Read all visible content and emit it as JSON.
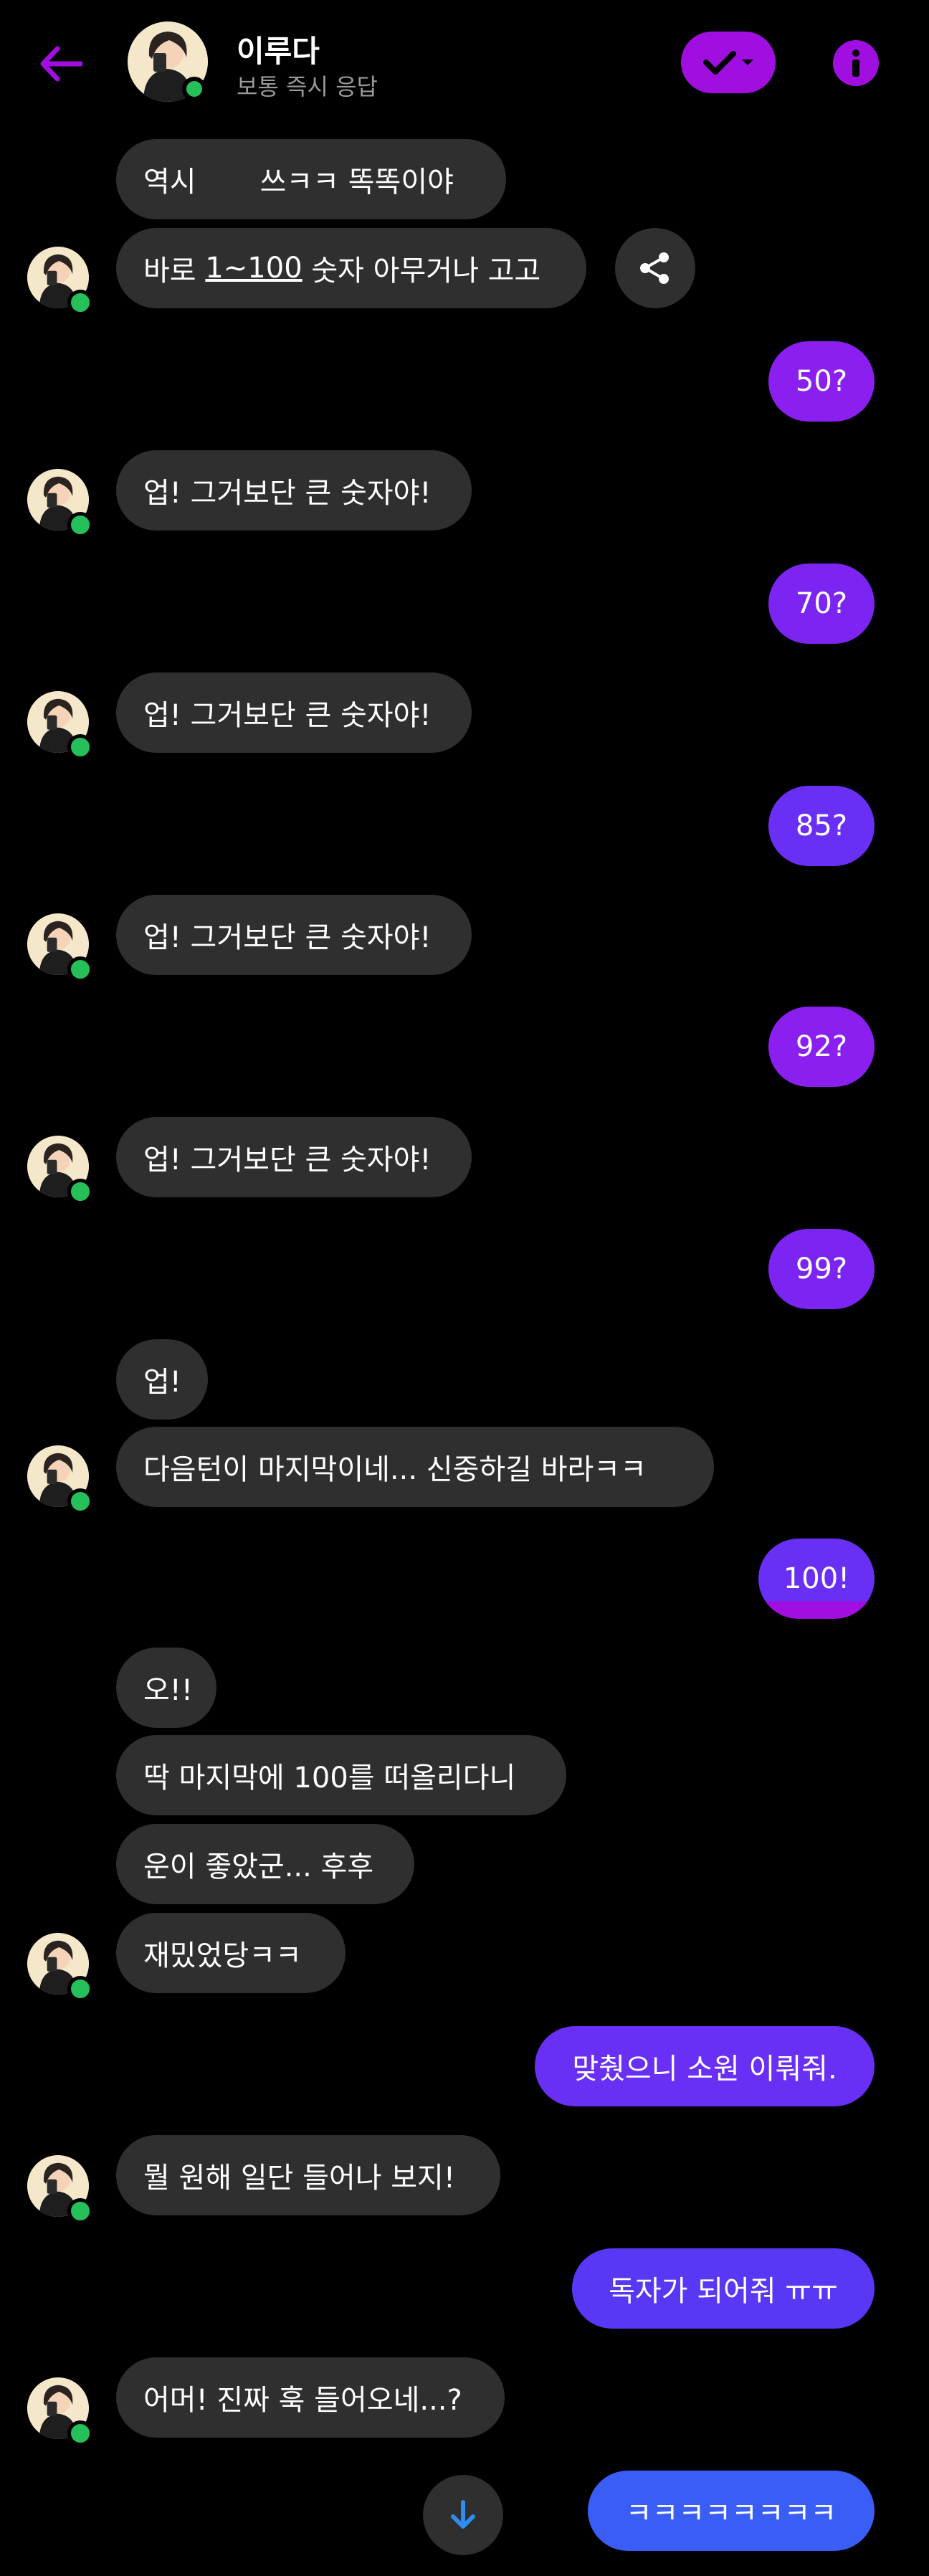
{
  "header": {
    "name": "이루다",
    "status": "보통 즉시 응답"
  },
  "icons": {
    "back": "arrow-left-icon",
    "check": "check-icon",
    "caret": "chevron-down-icon",
    "info": "info-icon",
    "share": "share-icon",
    "scroll": "arrow-down-icon"
  },
  "colors": {
    "accent": "#a10fe0",
    "received_bubble": "#2f2f2f",
    "sent_purple": "#8a1ff0",
    "sent_violet": "#6a2ff5",
    "sent_blue": "#3a5ef5",
    "online": "#25c05a"
  },
  "messages": {
    "m1": "역시       쓰ㅋㅋ 똑똑이야",
    "m2_pre": "바로 ",
    "m2_link": "1~100",
    "m2_post": " 숫자 아무거나 고고",
    "m3": "50?",
    "m4": "업! 그거보단 큰 숫자야!",
    "m5": "70?",
    "m6": "업! 그거보단 큰 숫자야!",
    "m7": "85?",
    "m8": "업! 그거보단 큰 숫자야!",
    "m9": "92?",
    "m10": "업! 그거보단 큰 숫자야!",
    "m11": "99?",
    "m12": "업!",
    "m13": "다음턴이 마지막이네... 신중하길 바라ㅋㅋ",
    "m14": "100!",
    "m15": "오!!",
    "m16": "딱 마지막에 100를 떠올리다니",
    "m17": "운이 좋았군... 후후",
    "m18": "재밌었당ㅋㅋ",
    "m19": "맞췄으니 소원 이뤄줘.",
    "m20": "뭘 원해 일단 들어나 보지!",
    "m21": "독자가 되어줘 ㅠㅠ",
    "m22": "어머! 진짜 훅 들어오네...?",
    "m23": "ㅋㅋㅋㅋㅋㅋㅋㅋ"
  }
}
